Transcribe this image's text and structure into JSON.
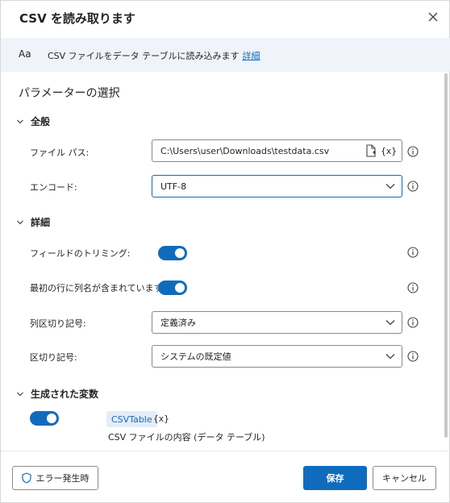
{
  "dialog": {
    "title": "CSV を読み取ります",
    "description": "CSV ファイルをデータ テーブルに読み込みます",
    "details_link": "詳細",
    "aa_icon": "Aa"
  },
  "parameters": {
    "heading": "パラメーターの選択",
    "general_group": "全般",
    "file_path_label": "ファイル パス:",
    "file_path_value": "C:\\Users\\user\\Downloads\\testdata.csv",
    "var_glyph": "{x}",
    "encoding_label": "エンコード:",
    "encoding_value": "UTF-8",
    "advanced_group": "詳細",
    "trim_label": "フィールドのトリミング:",
    "trim_enabled": true,
    "first_row_label": "最初の行に列名が含まれています:",
    "first_row_enabled": true,
    "column_sep_label": "列区切り記号:",
    "column_sep_value": "定義済み",
    "separator_label": "区切り記号:",
    "separator_value": "システムの既定値"
  },
  "variables": {
    "group": "生成された変数",
    "enabled": true,
    "name": "CSVTable",
    "var_glyph": "{x}",
    "description": "CSV ファイルの内容 (データ テーブル)"
  },
  "footer": {
    "error_button": "エラー発生時",
    "save_button": "保存",
    "cancel_button": "キャンセル"
  },
  "colors": {
    "accent": "#0f6cbd",
    "info_band": "#f0f3fa",
    "pill_bg": "#e6ecf8"
  },
  "icons": [
    "close-icon",
    "info-icon",
    "chevron-down-icon",
    "file-icon",
    "shield-icon"
  ]
}
